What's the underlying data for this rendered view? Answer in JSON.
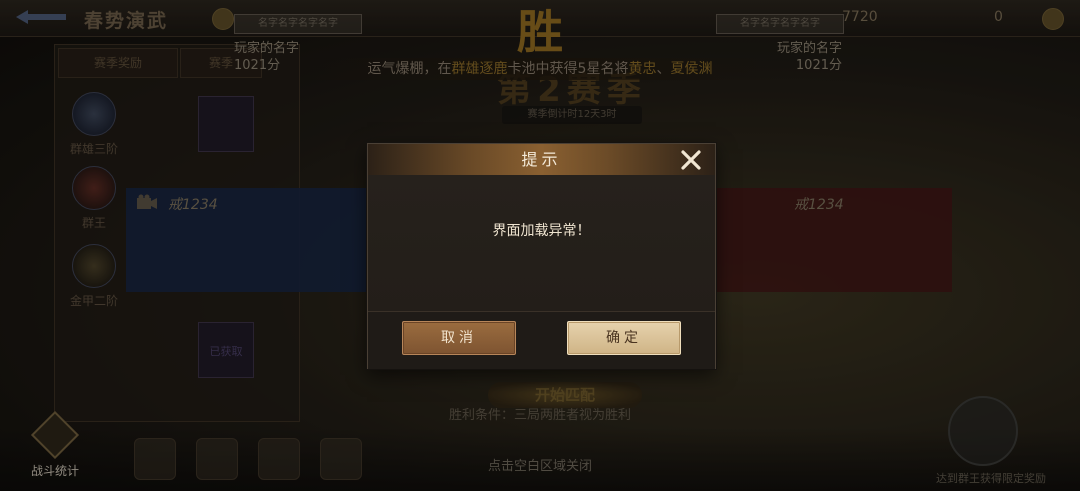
{
  "background": {
    "title": "春势演武",
    "resource_value": "7720",
    "resource_value_2": "0",
    "side_tabs": [
      "赛季奖励",
      "赛季"
    ],
    "rank_items": [
      "群雄三阶",
      "群王",
      "金甲二阶"
    ],
    "card_slot_label": "已获取",
    "victory_char": "胜",
    "season_title": "第2赛季",
    "countdown": "赛季倒计时12天3时",
    "lucky_banner": {
      "prefix": "运气爆棚，在",
      "pool": "群雄逐鹿",
      "middle": "卡池中获得5星名将",
      "hero1": "黄忠",
      "separator": "、",
      "hero2": "夏侯渊"
    },
    "left_player": {
      "name_box": "名字名字名字名字",
      "name": "玩家的名字",
      "score": "1021分"
    },
    "right_player": {
      "name_box": "名字名字名字名字",
      "name": "玩家的名字",
      "score": "1021分"
    },
    "blue_team_name": "戒1234",
    "red_team_name": "戒1234",
    "start_match": "开始匹配",
    "victory_rule": "胜利条件：三局两胜者视为胜利",
    "close_hint": "点击空白区域关闭",
    "battle_stats_label": "战斗统计",
    "top_reward_label": "达到群王获得限定奖励"
  },
  "dialog": {
    "title": "提示",
    "message": "界面加载异常！",
    "cancel_label": "取消",
    "confirm_label": "确定"
  },
  "colors": {
    "dialog_bg": "#221e1a",
    "header_accent": "#8a6031",
    "cancel_button": "#8d603a",
    "confirm_button": "#dcc39a",
    "dialog_text": "#efe4d0"
  },
  "icons": {
    "back": "back-arrow-icon",
    "close": "close-icon",
    "camera": "camera-icon",
    "battle_stats": "battle-stats-icon",
    "cup": "cup-icon"
  }
}
